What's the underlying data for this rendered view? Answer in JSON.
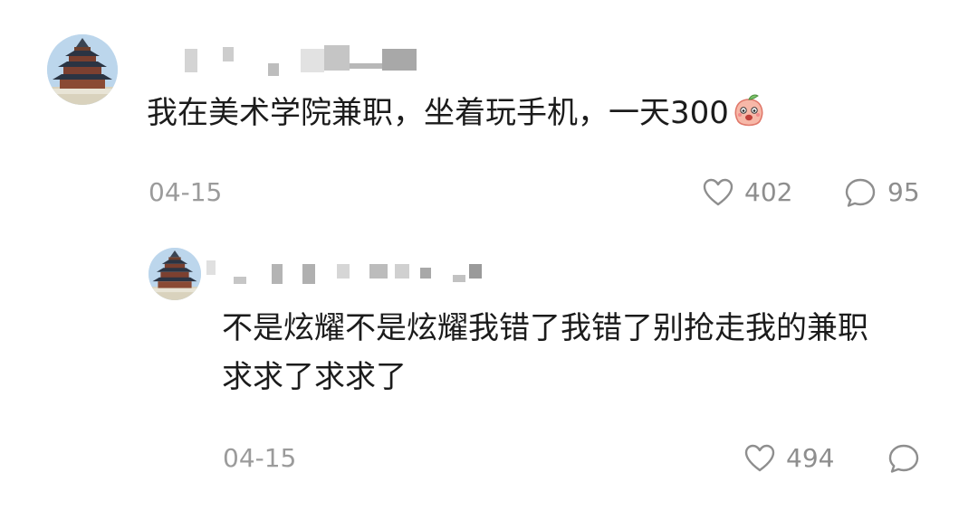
{
  "comments": [
    {
      "avatar_icon": "temple-of-heaven-avatar-icon",
      "text": "我在美术学院兼职，坐着玩手机，一天300",
      "emoji_icon": "peach-emoji-icon",
      "date": "04-15",
      "likes": "402",
      "replies": "95"
    },
    {
      "avatar_icon": "temple-of-heaven-avatar-icon",
      "text_lines": [
        "不是炫耀不是炫耀我错了我错了别抢走我的兼职",
        "求求了求求了"
      ],
      "date": "04-15",
      "likes": "494",
      "replies": ""
    }
  ],
  "colors": {
    "text": "#1b1b1b",
    "meta": "#9b9b9b",
    "redaction": "#c8c8c8"
  }
}
